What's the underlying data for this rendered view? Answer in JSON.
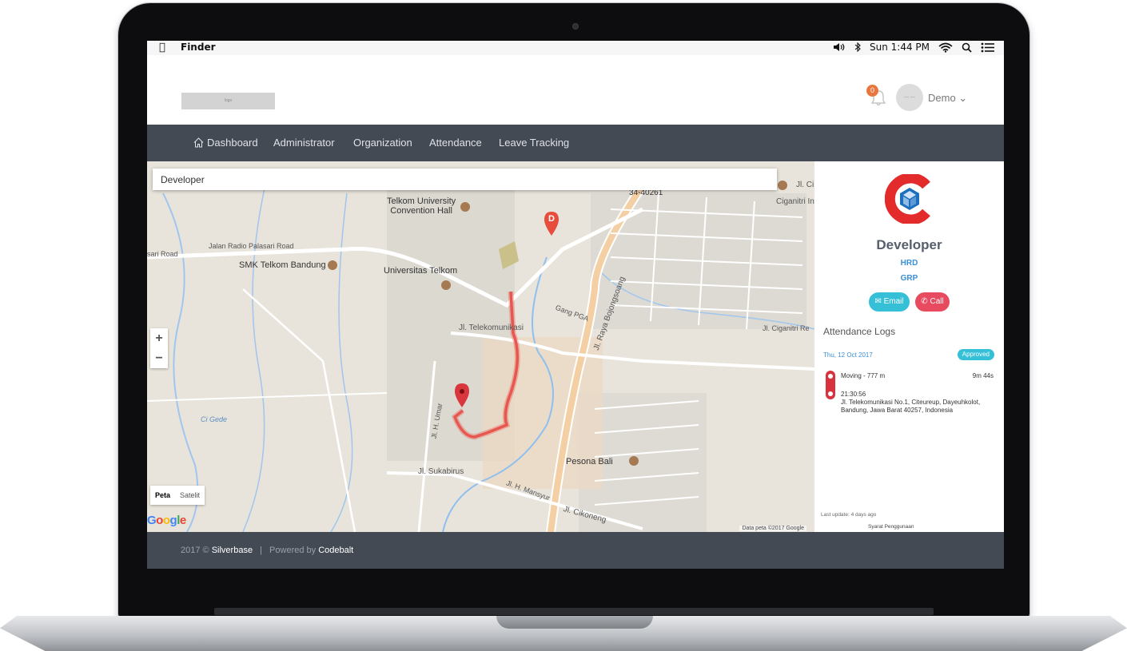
{
  "menubar": {
    "app_name": "Finder",
    "clock": "Sun 1:44 PM"
  },
  "header": {
    "logo_text": "logo",
    "notification_count": "0",
    "avatar_text": "— —",
    "user_name": "Demo ⌄"
  },
  "nav": {
    "items": [
      "Dashboard",
      "Administrator",
      "Organization",
      "Attendance",
      "Leave Tracking"
    ]
  },
  "map": {
    "search_value": "Developer",
    "labels": {
      "telkom_conv": "Telkom University\nConvention Hall",
      "smk": "SMK Telkom Bandung",
      "univ": "Universitas Telkom",
      "jalan_radio": "Jalan Radio Palasari Road",
      "sari_road": "sari Road",
      "jl_telekom": "Jl. Telekomunikasi",
      "gang_pga": "Gang PGA",
      "raya_bojongsoang": "Jl. Raya Bojongsoang",
      "ciganitri": "Jl. Ciganitri Re",
      "ci_gede": "Ci Gede",
      "sukabirus": "Jl. Sukabirus",
      "pesona": "Pesona Bali",
      "mansyur": "Jl. H. Mansyur",
      "cikoneng": "Jl. Cikoneng",
      "h_umar": "Jl. H. Umar",
      "ciganitri_in": "Ciganitri In",
      "road_34": "34-40261",
      "jl_cig": "Jl. Ci"
    },
    "zoom_in": "+",
    "zoom_out": "−",
    "map_type_map": "Peta",
    "map_type_satellite": "Satelit",
    "google": "Google",
    "credit": "Data peta ©2017 Google",
    "destination_marker": "D",
    "route_color": "#e8574f"
  },
  "panel": {
    "name": "Developer",
    "department": "HRD",
    "group": "GRP",
    "email_label": "Email",
    "call_label": "Call",
    "attendance_title": "Attendance Logs",
    "log_date": "Thu, 12 Oct 2017",
    "log_status": "Approved",
    "moving": "Moving - 777 m",
    "duration": "9m 44s",
    "time": "21:30:56",
    "address": "Jl. Telekomunikasi No.1, Citeureup, Dayeuhkolot, Bandung, Jawa Barat 40257, Indonesia",
    "last_update": "Last update: 4 days ago",
    "terms": "Syarat Penggunaan"
  },
  "footer": {
    "year": "2017 ©",
    "brand": "Silverbase",
    "sep": "|",
    "powered_by": "Powered by",
    "powered_brand": "Codebalt"
  },
  "colors": {
    "navbar": "#434a54",
    "accent_blue": "#3a8fd6",
    "teal": "#35c0d8",
    "red": "#e84a5f",
    "logo_red": "#e32b2b",
    "logo_blue": "#1c6fbd"
  }
}
